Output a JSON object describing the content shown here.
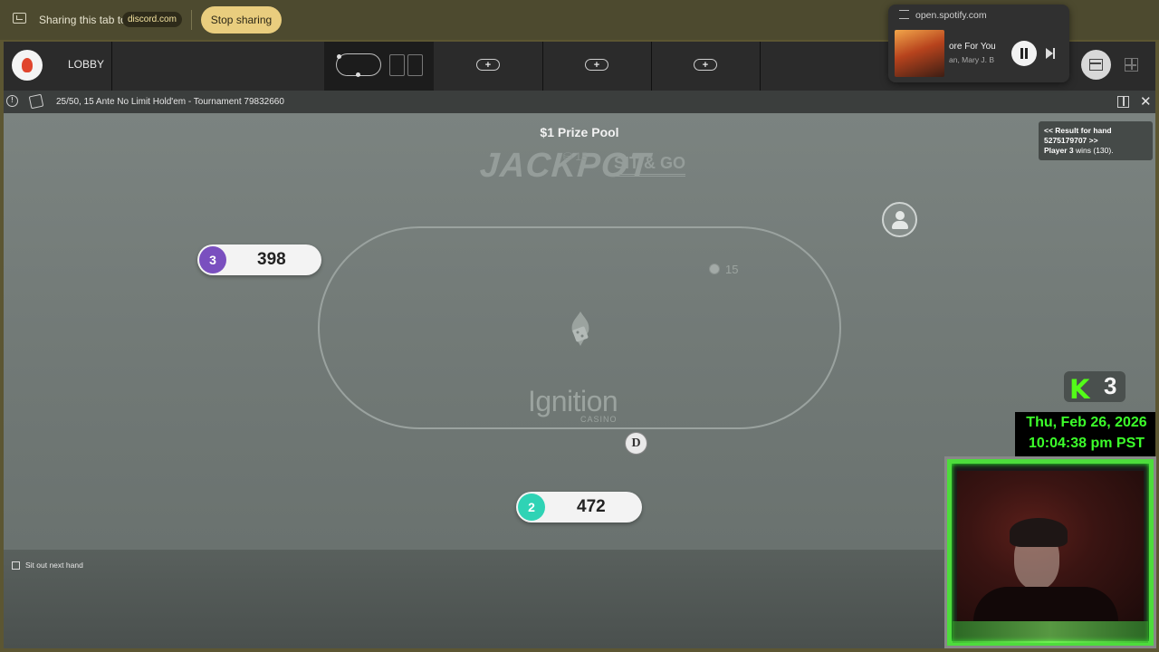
{
  "share_bar": {
    "text": "Sharing this tab to",
    "domain": "discord.com",
    "stop_label": "Stop sharing"
  },
  "nav": {
    "lobby_label": "LOBBY",
    "add_table_slots": [
      "+",
      "+",
      "+"
    ]
  },
  "table_header": {
    "title": "25/50, 15 Ante No Limit Hold'em - Tournament 79832660"
  },
  "table": {
    "prize_pool": "$1 Prize Pool",
    "jackpot_word": "JACKPOT",
    "sitgo_word": "SIT & GO",
    "pot_top": "15",
    "bet_amount": "15",
    "brand": "Ignition",
    "brand_sub": "CASINO",
    "dealer_button": "D",
    "seats": [
      {
        "number": "3",
        "stack": "398",
        "color": "#7a4fbf"
      },
      {
        "number": "2",
        "stack": "472",
        "color": "#2fd3b5"
      }
    ]
  },
  "result_notice": {
    "line1": "<< Result for hand",
    "line2": "5275179707 >>",
    "player": "Player 3",
    "wins": "wins (130)."
  },
  "footer": {
    "sit_out_label": "Sit out next hand"
  },
  "spotify": {
    "url": "open.spotify.com",
    "track": "ore For You",
    "artist": "an, Mary J. B"
  },
  "overlay": {
    "kick_count": "3",
    "date": "Thu, Feb 26, 2026",
    "time": "10:04:38 pm PST"
  },
  "colors": {
    "accent_gold": "#e9cd7e",
    "kick_green": "#53fc18",
    "clock_green": "#3cff2a",
    "seat3": "#7a4fbf",
    "seat2": "#2fd3b5"
  }
}
